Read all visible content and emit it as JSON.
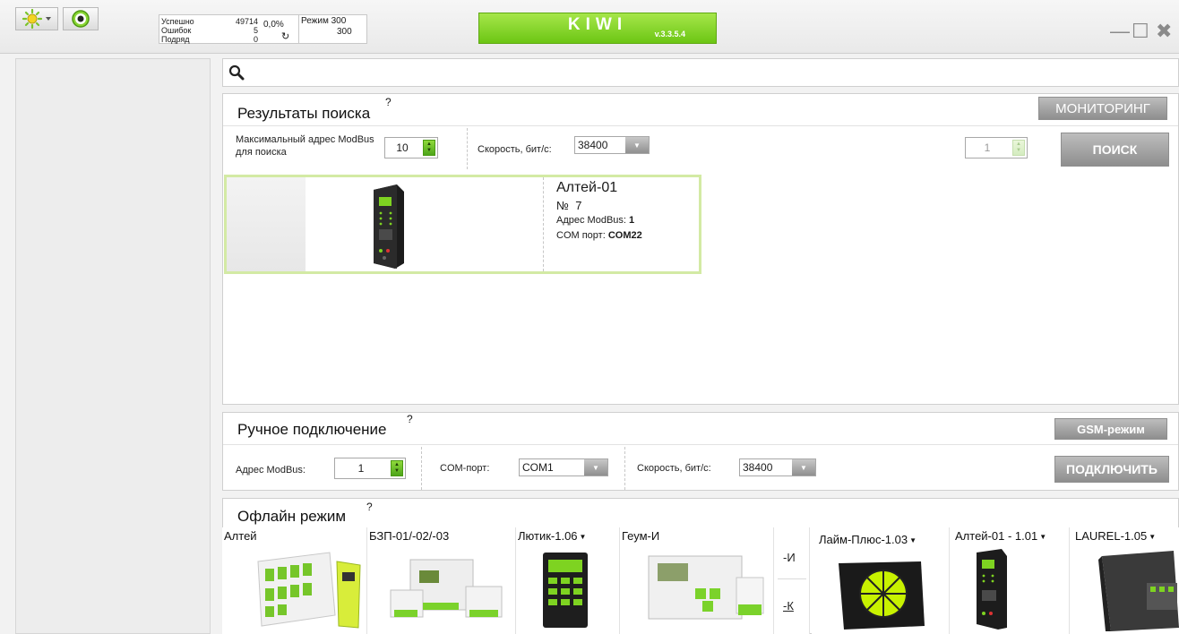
{
  "topbar": {
    "stats": {
      "labels": [
        "Успешно",
        "Ошибок",
        "Подряд"
      ],
      "values": [
        "49714",
        "5",
        "0"
      ],
      "percent": "0,0%",
      "refresh_icon": "refresh-icon",
      "mode_label": "Режим 300",
      "mode_value": "300"
    },
    "brand": "KIWI",
    "version": "v.3.3.5.4",
    "icons": [
      "sun-icon",
      "target-icon",
      "minimize-icon",
      "maximize-icon",
      "close-icon"
    ],
    "minimize_glyph": "—",
    "maximize_glyph": "☐",
    "close_glyph": "✖"
  },
  "search": {
    "placeholder": "",
    "icon": "search-icon"
  },
  "results": {
    "title": "Результаты поиска",
    "hint": "?",
    "monitoring_label": "МОНИТОРИНГ",
    "max_address_label": "Максимальный адрес ModBus для поиска",
    "max_address_value": "10",
    "speed_label": "Скорость, бит/с:",
    "speed_value": "38400",
    "count_value": "1",
    "search_label": "ПОИСК",
    "device": {
      "name": "Алтей-01",
      "number_label": "№",
      "number": "7",
      "address_label": "Адрес  ModBus:",
      "address": "1",
      "port_label": "COM порт:",
      "port": "COM22"
    }
  },
  "manual": {
    "title": "Ручное подключение",
    "hint": "?",
    "gsm_label": "GSM-режим",
    "address_label": "Адрес ModBus:",
    "address_value": "1",
    "port_label": "COM-порт:",
    "port_value": "COM1",
    "speed_label": "Скорость, бит/с:",
    "speed_value": "38400",
    "connect_label": "ПОДКЛЮЧИТЬ"
  },
  "offline": {
    "title": "Офлайн режим",
    "hint": "?",
    "devices": [
      {
        "name": "Алтей",
        "dropdown": false
      },
      {
        "name": "БЗП-01/-02/-03",
        "dropdown": false
      },
      {
        "name": "Лютик-1.06",
        "dropdown": true
      },
      {
        "name": "Геум-И",
        "dropdown": false
      },
      {
        "name": "Лайм-Плюс-1.03",
        "dropdown": true
      },
      {
        "name": "Алтей-01 - 1.01",
        "dropdown": true
      },
      {
        "name": "LAUREL-1.05",
        "dropdown": true
      }
    ],
    "variant_i": "-И",
    "variant_k": "-К"
  },
  "colors": {
    "accent": "#7ad21f",
    "button_grey": "#9e9e9e",
    "card_border": "#d3eaa4"
  }
}
